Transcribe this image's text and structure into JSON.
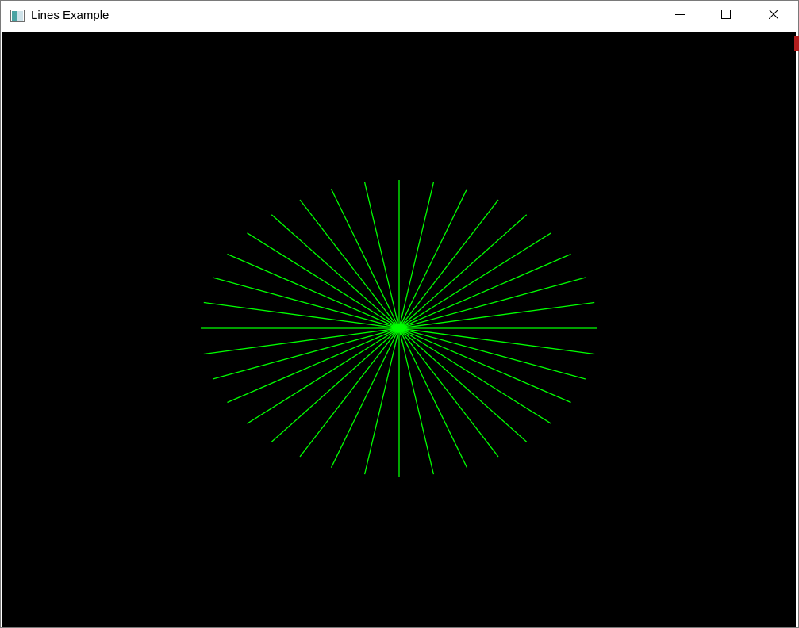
{
  "window": {
    "title": "Lines Example"
  },
  "titlebar": {
    "icons": {
      "app": "app-window-icon",
      "minimize": "minimize-icon",
      "maximize": "maximize-icon",
      "close": "close-icon"
    }
  },
  "canvas": {
    "background": "#000000",
    "line_color": "#00ff00",
    "line_count": 36,
    "angle_step_degrees": 10
  }
}
